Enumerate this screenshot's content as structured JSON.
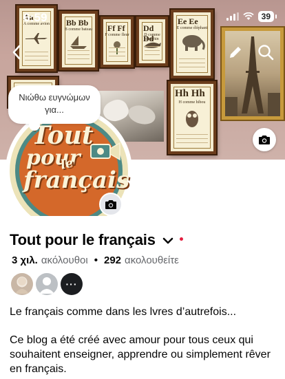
{
  "status_bar": {
    "time": "6:59",
    "battery": "39"
  },
  "cover": {
    "cards": [
      {
        "letters": "Aa",
        "word": "A comme avion"
      },
      {
        "letters": "Bb Bb",
        "word": "B comme bateau"
      },
      {
        "letters": "Ff Ff",
        "word": "F comme fleur"
      },
      {
        "letters": "Dd Dd",
        "word": "D comme dauphin"
      },
      {
        "letters": "Ee Ee",
        "word": "E comme éléphant"
      },
      {
        "letters": "Hh Hh",
        "word": "H comme hibou"
      }
    ]
  },
  "bubble": {
    "text": "Νιώθω ευγνώμων για..."
  },
  "logo": {
    "line1": "Tout",
    "line2": "pour",
    "line3": "le",
    "line4": "français"
  },
  "profile": {
    "name": "Tout pour le français",
    "followers_count": "3 χιλ.",
    "followers_label": "ακόλουθοι",
    "following_count": "292",
    "following_label": "ακολουθείτε",
    "more_friends": "···"
  },
  "bio": {
    "line1": "Le français comme dans les lvres d’autrefois...",
    "line2": "Ce blog a été créé avec amour pour tous ceux qui souhaitent enseigner, apprendre ou simplement rêver en français."
  },
  "colors": {
    "logo_orange": "#d4682a",
    "logo_teal": "#4d8a85",
    "logo_cream": "#ece3b8",
    "notification_red": "#e41e3f"
  }
}
